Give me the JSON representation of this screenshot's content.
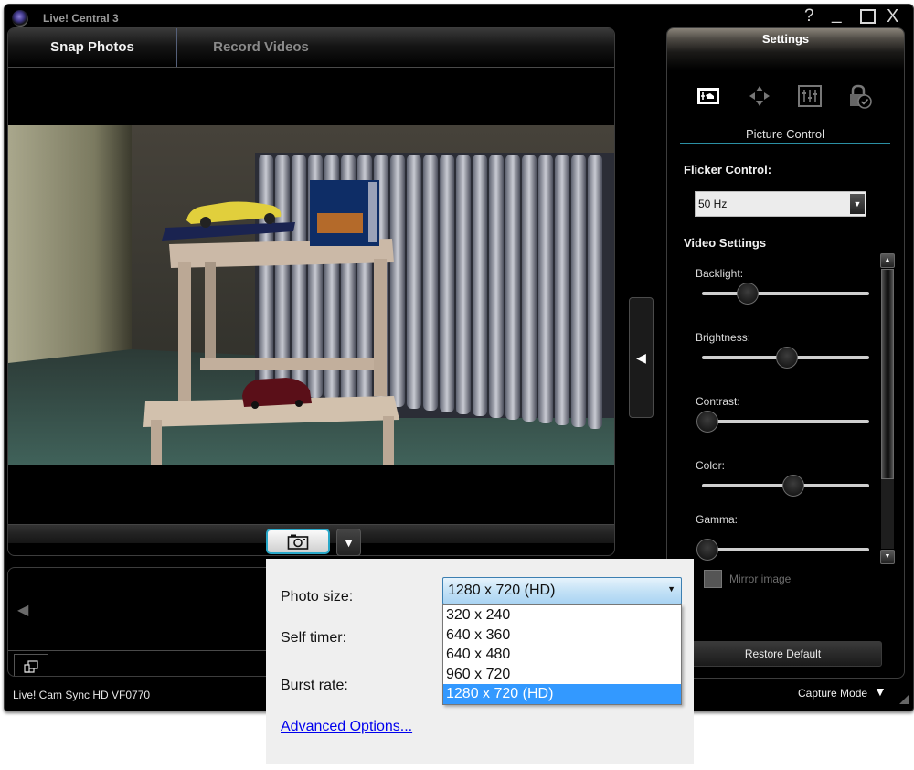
{
  "window": {
    "title": "Live! Central 3",
    "controls": {
      "help": "?",
      "minimize": "_",
      "close": "X"
    }
  },
  "tabs": [
    {
      "label": "Snap Photos",
      "active": true
    },
    {
      "label": "Record Videos",
      "active": false
    }
  ],
  "preview": {
    "description": "Live webcam feed: wooden step stool with toy cars and a box in front of a radiator"
  },
  "capture": {
    "snap_icon": "camera-icon",
    "menu_icon": "triangle-down-icon"
  },
  "gallery": {
    "prev_icon": "triangle-left-icon",
    "stack_icon": "stack-icon"
  },
  "status": {
    "device_name": "Live! Cam Sync HD VF0770",
    "capture_mode_label": "Capture Mode"
  },
  "settings": {
    "header": "Settings",
    "icons": [
      "picture-control-icon",
      "pan-tilt-icon",
      "equalizer-icon",
      "lock-check-icon"
    ],
    "active_section": "Picture Control",
    "flicker_label": "Flicker Control:",
    "flicker_value": "50 Hz",
    "video_settings_label": "Video Settings",
    "sliders": [
      {
        "label": "Backlight:",
        "value": 0.27
      },
      {
        "label": "Brightness:",
        "value": 0.5
      },
      {
        "label": "Contrast:",
        "value": 0.03
      },
      {
        "label": "Color:",
        "value": 0.54
      },
      {
        "label": "Gamma:",
        "value": 0.03
      }
    ],
    "scroll_position": 0.0,
    "mirror_label": "Mirror image",
    "mirror_checked": false,
    "restore_label": "Restore Default"
  },
  "photo_options": {
    "photo_size_label": "Photo size:",
    "self_timer_label": "Self timer:",
    "burst_rate_label": "Burst rate:",
    "photo_size_value": "1280 x 720 (HD)",
    "photo_size_options": [
      "320 x 240",
      "640 x 360",
      "640 x 480",
      "960 x 720",
      "1280 x 720 (HD)"
    ],
    "selected_index": 4,
    "advanced_link": "Advanced Options..."
  },
  "colors": {
    "accent_cyan": "#29a8c9",
    "selection_blue": "#3399ff",
    "link_blue": "#0000ee"
  }
}
